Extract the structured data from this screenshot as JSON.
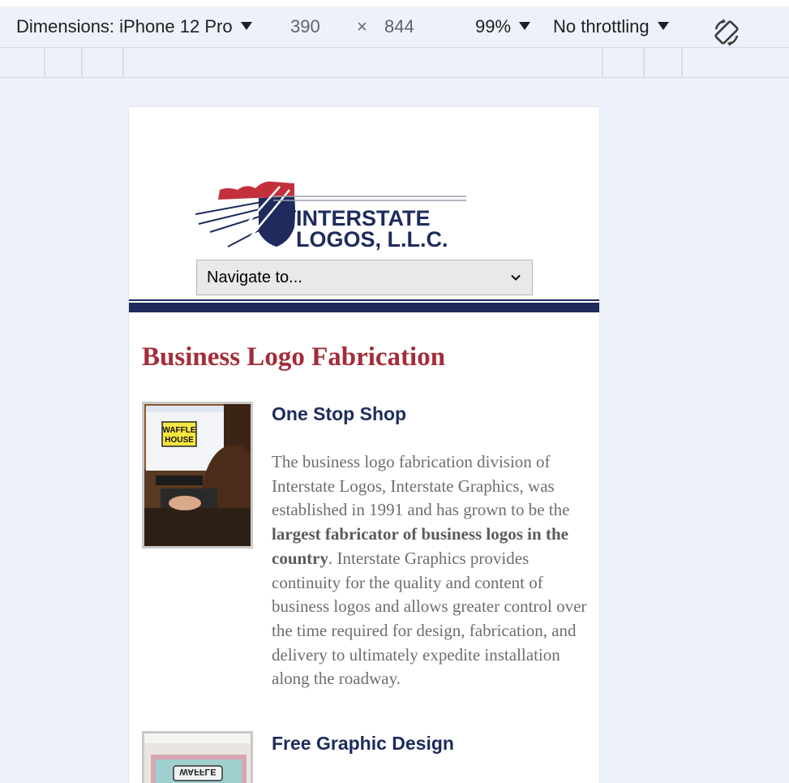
{
  "devtools": {
    "dimensions_label": "Dimensions: iPhone 12 Pro",
    "width_value": "390",
    "times_symbol": "×",
    "height_value": "844",
    "zoom_label": "99%",
    "throttling_label": "No throttling"
  },
  "site": {
    "logo": {
      "line1": "INTERSTATE",
      "line2": "LOGOS, L.L.C.",
      "colors": {
        "shield": "#1e2b5c",
        "banner": "#c3303c"
      }
    },
    "nav_select": {
      "selected": "Navigate to..."
    },
    "page_title": "Business Logo Fabrication",
    "sections": [
      {
        "heading": "One Stop Shop",
        "thumb_sign": [
          "WAFFLE",
          "HOUSE"
        ],
        "body_before": "The business logo fabrication division of Interstate Logos, Interstate Graphics, was established in 1991 and has grown to be the ",
        "body_bold": "largest fabricator of business logos in the country",
        "body_after": ". Interstate Graphics provides continuity for the quality and content of business logos and allows greater control over the time required for design, fabrication, and delivery to ultimately expedite installation along the roadway."
      },
      {
        "heading": "Free Graphic Design",
        "thumb_sign": "WAFFLE"
      }
    ]
  },
  "colors": {
    "title_red": "#a32d3a",
    "heading_navy": "#1e2b5c",
    "body_gray": "#6e6e6e",
    "devtools_bg": "#edf1f9"
  }
}
